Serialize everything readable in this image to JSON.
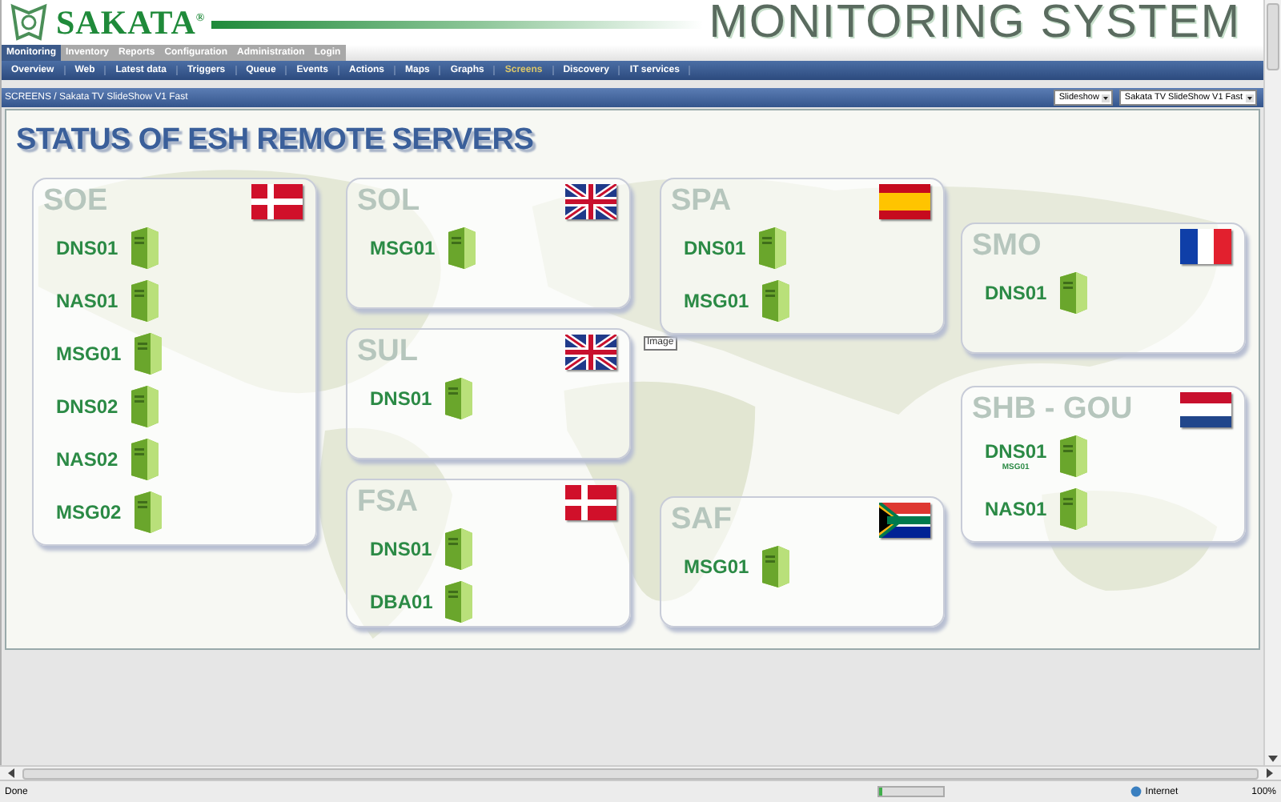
{
  "header": {
    "logo": "SAKATA$^{®}$",
    "title": "MONITORING SYSTEM"
  },
  "main_menu": [
    {
      "label": "Monitoring",
      "selected": true
    },
    {
      "label": "Inventory",
      "selected": false
    },
    {
      "label": "Reports",
      "selected": false
    },
    {
      "label": "Configuration",
      "selected": false
    },
    {
      "label": "Administration",
      "selected": false
    },
    {
      "label": "Login",
      "selected": false
    }
  ],
  "sub_menu": [
    {
      "label": "Overview",
      "selected": false
    },
    {
      "label": "Web",
      "selected": false
    },
    {
      "label": "Latest data",
      "selected": false
    },
    {
      "label": "Triggers",
      "selected": false
    },
    {
      "label": "Queue",
      "selected": false
    },
    {
      "label": "Events",
      "selected": false
    },
    {
      "label": "Actions",
      "selected": false
    },
    {
      "label": "Maps",
      "selected": false
    },
    {
      "label": "Graphs",
      "selected": false
    },
    {
      "label": "Screens",
      "selected": true
    },
    {
      "label": "Discovery",
      "selected": false
    },
    {
      "label": "IT services",
      "selected": false
    }
  ],
  "breadcrumb": "SCREENS / Sakata TV SlideShow V1 Fast",
  "selects": [
    "Slideshow",
    "Sakata TV SlideShow V1 Fast"
  ],
  "screen": {
    "title": "STATUS OF ESH REMOTE SERVERS",
    "image_placeholder": "Image",
    "columns": [
      [
        {
          "name": "SOE",
          "kind": "denmark",
          "servers": [
            {
              "name": "DNS01"
            },
            {
              "name": "NAS01"
            },
            {
              "name": "MSG01"
            },
            {
              "name": "DNS02"
            },
            {
              "name": "NAS02"
            },
            {
              "name": "MSG02"
            }
          ]
        }
      ],
      [
        {
          "name": "SOL",
          "kind": "uk",
          "servers": [
            {
              "name": "MSG01"
            }
          ]
        },
        {
          "name": "SUL",
          "kind": "uk",
          "servers": [
            {
              "name": "DNS01"
            }
          ]
        },
        {
          "name": "FSA",
          "kind": "denmark",
          "servers": [
            {
              "name": "DNS01"
            },
            {
              "name": "DBA01"
            }
          ]
        }
      ],
      [
        {
          "name": "SPA",
          "kind": "spain",
          "servers": [
            {
              "name": "DNS01"
            },
            {
              "name": "MSG01"
            }
          ]
        },
        {
          "name": "SAF",
          "kind": "south_africa",
          "servers": [
            {
              "name": "MSG01"
            }
          ]
        }
      ],
      [
        {
          "name": "SMO",
          "kind": "france",
          "servers": [
            {
              "name": "DNS01"
            }
          ]
        },
        {
          "name": "SHB - GOU",
          "kind": "netherlands",
          "servers": [
            {
              "name": "DNS01",
              "note": "MSG01"
            },
            {
              "name": "NAS01"
            }
          ]
        }
      ]
    ]
  },
  "status_bar": {
    "text": "Done",
    "level": 0.05,
    "zone": "Internet",
    "zoom": "100%"
  }
}
